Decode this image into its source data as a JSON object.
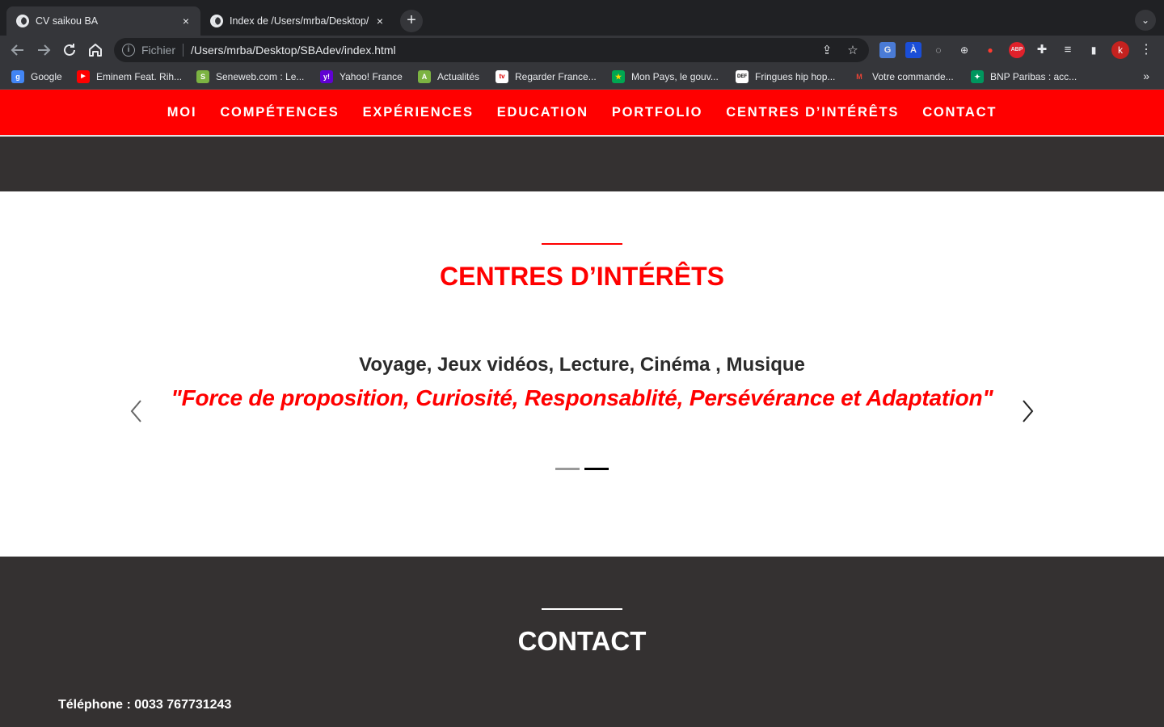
{
  "browser": {
    "tabs": [
      {
        "title": "CV saikou BA",
        "close": "×"
      },
      {
        "title": "Index de /Users/mrba/Desktop/",
        "close": "×"
      }
    ],
    "new_tab": "+",
    "tab_search": "⌄",
    "address": {
      "scheme": "Fichier",
      "url": "/Users/mrba/Desktop/SBAdev/index.html"
    },
    "profile_initial": "k",
    "bookmarks": [
      {
        "label": "Google",
        "color": "#4285f4",
        "glyph": "g"
      },
      {
        "label": "Eminem Feat. Rih...",
        "color": "#ff0000",
        "glyph": "▶"
      },
      {
        "label": "Seneweb.com : Le...",
        "color": "#7cb342",
        "glyph": "S"
      },
      {
        "label": "Yahoo! France",
        "color": "#6001d2",
        "glyph": "y!"
      },
      {
        "label": "Actualités",
        "color": "#7cb342",
        "glyph": "A"
      },
      {
        "label": "Regarder France...",
        "color": "#ffffff",
        "glyph": "tv"
      },
      {
        "label": "Mon Pays, le gouv...",
        "color": "#00a651",
        "glyph": "★"
      },
      {
        "label": "Fringues hip hop...",
        "color": "#ffffff",
        "glyph": "DEF"
      },
      {
        "label": "Votre commande...",
        "color": "#ea4335",
        "glyph": "M"
      },
      {
        "label": "BNP Paribas : acc...",
        "color": "#00965e",
        "glyph": "✦"
      }
    ],
    "bookmarks_more": "»"
  },
  "nav": {
    "items": [
      "MOI",
      "COMPÉTENCES",
      "EXPÉRIENCES",
      "EDUCATION",
      "PORTFOLIO",
      "CENTRES D’INTÉRÊTS",
      "CONTACT"
    ]
  },
  "interests": {
    "title": "CENTRES D’INTÉRÊTS",
    "slide_line1": "Voyage, Jeux vidéos, Lecture, Cinéma , Musique",
    "slide_line2": "\"Force de proposition, Curiosité, Responsablité, Persévérance et Adaptation\"",
    "slide_count": 2,
    "active_slide": 1
  },
  "contact": {
    "title": "CONTACT",
    "phone": "Téléphone : 0033 767731243"
  },
  "colors": {
    "accent": "#ff0000",
    "dark": "#343131"
  }
}
